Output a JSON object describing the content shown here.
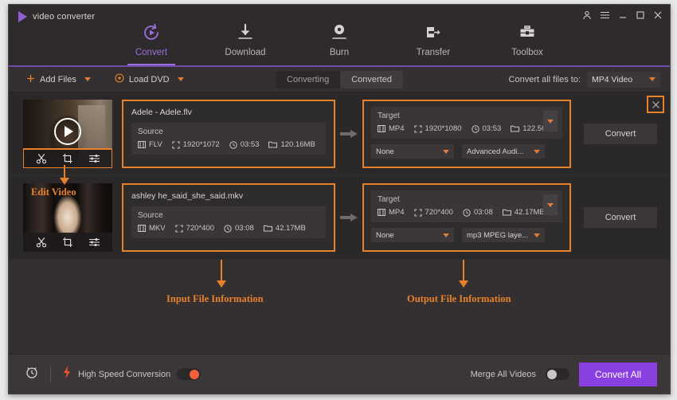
{
  "window": {
    "brand": "video converter",
    "controls": [
      {
        "name": "account-icon",
        "title": "Account"
      },
      {
        "name": "menu-icon",
        "title": "Menu"
      },
      {
        "name": "minimize-icon",
        "title": "Minimize"
      },
      {
        "name": "maximize-icon",
        "title": "Maximize"
      },
      {
        "name": "close-icon",
        "title": "Close"
      }
    ]
  },
  "nav": {
    "items": [
      {
        "label": "Convert",
        "icon": "convert-icon",
        "active": true
      },
      {
        "label": "Download",
        "icon": "download-icon",
        "active": false
      },
      {
        "label": "Burn",
        "icon": "burn-icon",
        "active": false
      },
      {
        "label": "Transfer",
        "icon": "transfer-icon",
        "active": false
      },
      {
        "label": "Toolbox",
        "icon": "toolbox-icon",
        "active": false
      }
    ]
  },
  "toolbar": {
    "add_files": "Add Files",
    "load_dvd": "Load DVD",
    "tabs": [
      {
        "label": "Converting",
        "active": true
      },
      {
        "label": "Converted",
        "active": false
      }
    ],
    "convert_all_to_label": "Convert all files to:",
    "convert_all_to_value": "MP4 Video"
  },
  "file_list": {
    "close_label": "✕",
    "source_title": "Source",
    "target_title": "Target",
    "convert_button": "Convert",
    "rows": [
      {
        "filename": "Adele - Adele.flv",
        "source": {
          "format": "FLV",
          "resolution": "1920*1072",
          "duration": "03:53",
          "size": "120.16MB"
        },
        "target": {
          "format": "MP4",
          "resolution": "1920*1080",
          "duration": "03:53",
          "size": "122.50MB"
        },
        "subtitle_select": "None",
        "audio_select": "Advanced Audi...",
        "edit_tools": [
          "trim-icon",
          "crop-icon",
          "effect-icon"
        ],
        "has_play_overlay": true,
        "edit_tools_highlighted": true
      },
      {
        "filename": "ashley he_said_she_said.mkv",
        "source": {
          "format": "MKV",
          "resolution": "720*400",
          "duration": "03:08",
          "size": "42.17MB"
        },
        "target": {
          "format": "MP4",
          "resolution": "720*400",
          "duration": "03:08",
          "size": "42.17MB"
        },
        "subtitle_select": "None",
        "audio_select": "mp3 MPEG laye...",
        "edit_tools": [
          "trim-icon",
          "crop-icon",
          "effect-icon"
        ],
        "has_play_overlay": false,
        "edit_tools_highlighted": false
      }
    ]
  },
  "annotations": {
    "edit_video": "Edit Video",
    "input_file_information": "Input File Information",
    "output_file_information": "Output File Information"
  },
  "footer": {
    "timer_icon": "alarm-clock-icon",
    "high_speed_label": "High Speed Conversion",
    "high_speed_on": true,
    "merge_label": "Merge All Videos",
    "merge_on": false,
    "convert_all_button": "Convert All"
  },
  "colors": {
    "accent_purple": "#8a3fe0",
    "annotation_orange": "#e8812b",
    "toggle_on": "#f4603c",
    "window_bg": "#2d2a2b"
  }
}
